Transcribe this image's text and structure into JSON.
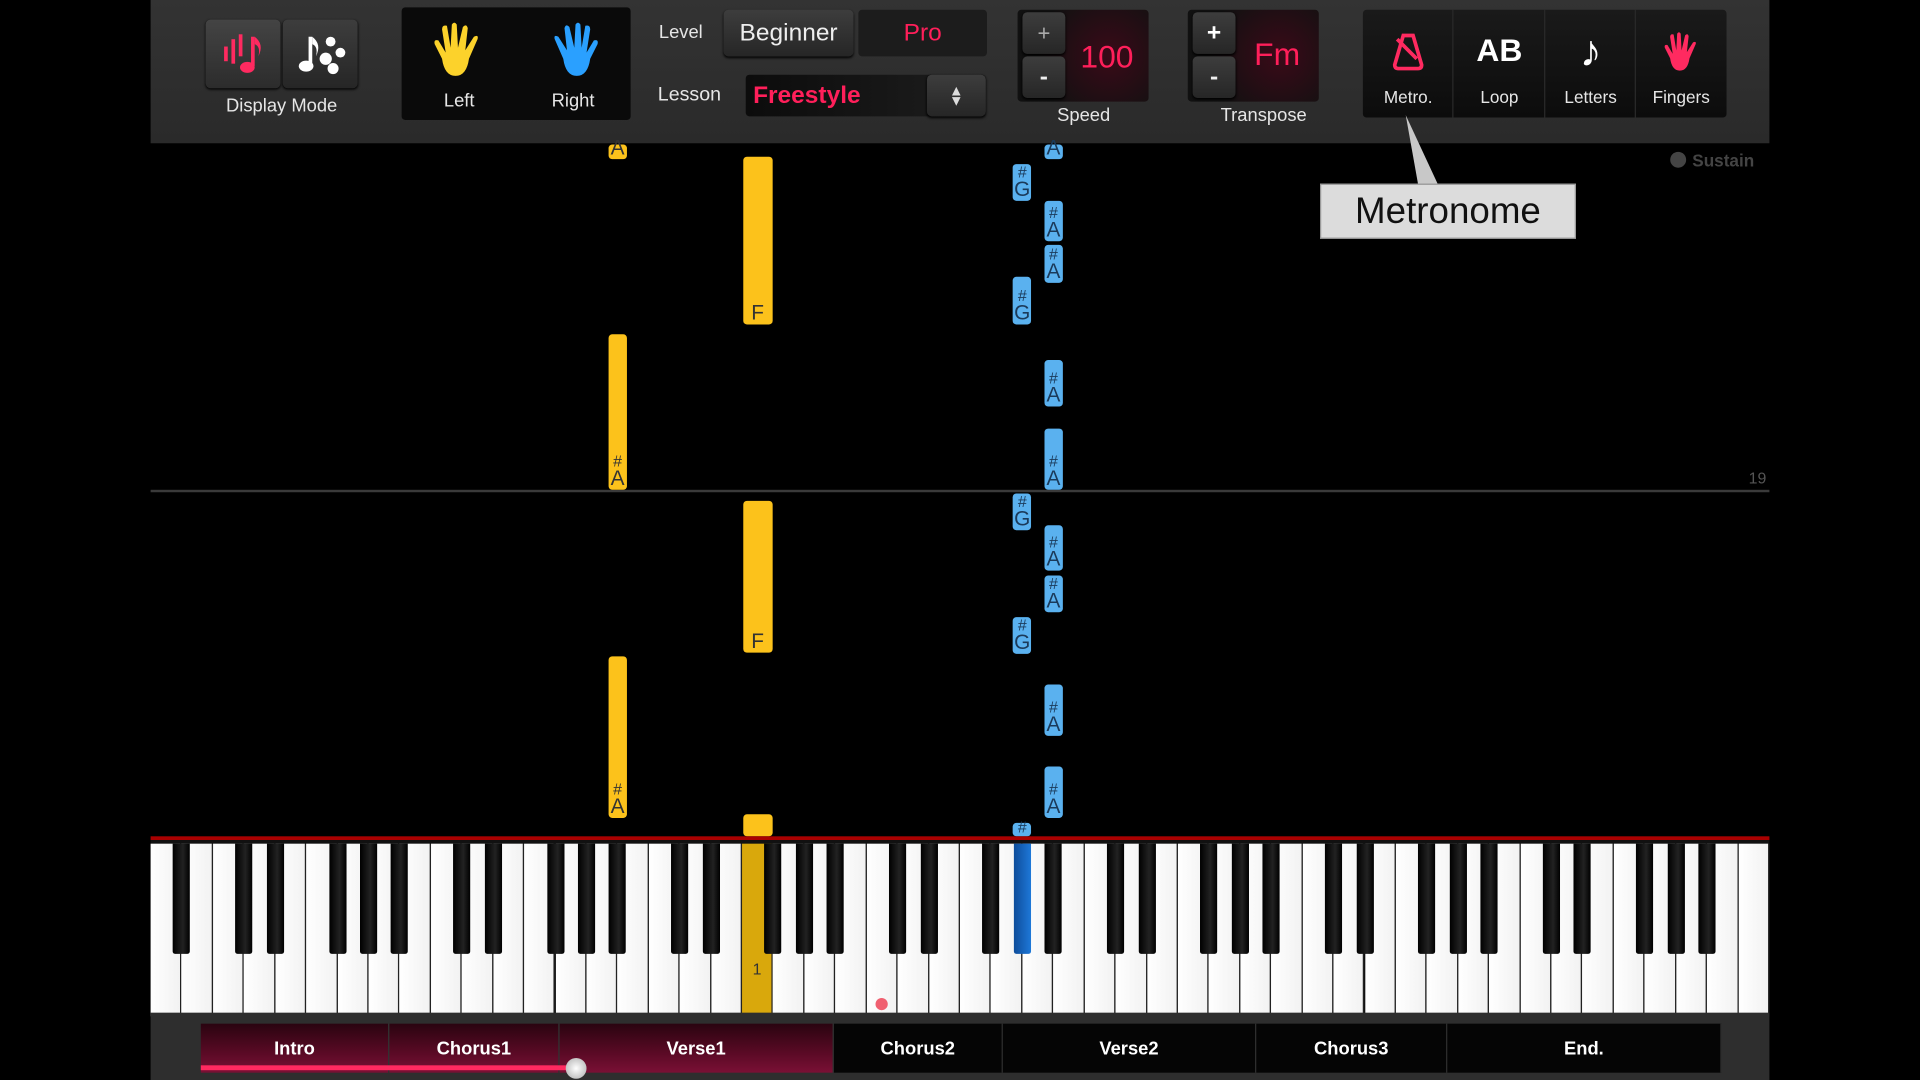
{
  "toolbar": {
    "display_mode": {
      "label": "Display Mode",
      "buttons": [
        {
          "icon": "falling-notes-icon",
          "active": true
        },
        {
          "icon": "sheet-notes-icon",
          "active": false
        }
      ]
    },
    "hands": {
      "left": "Left",
      "right": "Right",
      "left_color": "#fcc21b",
      "right_color": "#2aa0ff"
    },
    "level": {
      "label": "Level",
      "options": [
        "Beginner",
        "Pro"
      ],
      "selected": "Pro"
    },
    "lesson": {
      "label": "Lesson",
      "value": "Freestyle"
    },
    "speed": {
      "label": "Speed",
      "value": "100",
      "plus": "+",
      "minus": "-"
    },
    "transpose": {
      "label": "Transpose",
      "value": "Fm",
      "plus": "+",
      "minus": "-"
    },
    "tools": [
      {
        "label": "Metro.",
        "icon": "metronome-icon"
      },
      {
        "label": "Loop",
        "icon_text": "AB"
      },
      {
        "label": "Letters",
        "icon": "eighth-note-icon"
      },
      {
        "label": "Fingers",
        "icon": "hand-icon"
      }
    ]
  },
  "tooltip": {
    "text": "Metronome"
  },
  "sustain": {
    "label": "Sustain",
    "on": false
  },
  "measure_number": "19",
  "notes": [
    {
      "hand": "left",
      "pitch": "A#2",
      "labels": [
        "",
        "A"
      ]
    },
    {
      "hand": "left",
      "pitch": "A#2",
      "labels": [
        "#",
        "A"
      ]
    },
    {
      "hand": "left",
      "pitch": "A#2",
      "labels": [
        "#",
        "A"
      ]
    },
    {
      "hand": "left",
      "pitch": "F3",
      "labels": [
        "",
        "F"
      ]
    },
    {
      "hand": "left",
      "pitch": "F3",
      "labels": [
        "",
        "F"
      ]
    },
    {
      "hand": "left",
      "pitch": "F3",
      "labels": [
        "",
        ""
      ]
    },
    {
      "hand": "right",
      "pitch": "G#4",
      "labels": [
        "#",
        "G"
      ]
    },
    {
      "hand": "right",
      "pitch": "G#4",
      "labels": [
        "#",
        "G"
      ]
    },
    {
      "hand": "right",
      "pitch": "G#4",
      "labels": [
        "#",
        "G"
      ]
    },
    {
      "hand": "right",
      "pitch": "G#4",
      "labels": [
        "#",
        "G"
      ]
    },
    {
      "hand": "right",
      "pitch": "G#4",
      "labels": [
        "#",
        ""
      ]
    },
    {
      "hand": "right",
      "pitch": "A#4",
      "labels": [
        "",
        "A"
      ]
    },
    {
      "hand": "right",
      "pitch": "A#4",
      "labels": [
        "#",
        "A"
      ]
    },
    {
      "hand": "right",
      "pitch": "A#4",
      "labels": [
        "#",
        "A"
      ]
    },
    {
      "hand": "right",
      "pitch": "A#4",
      "labels": [
        "#",
        "A"
      ]
    },
    {
      "hand": "right",
      "pitch": "A#4",
      "labels": [
        "#",
        "A"
      ]
    },
    {
      "hand": "right",
      "pitch": "A#4",
      "labels": [
        "#",
        "A"
      ]
    },
    {
      "hand": "right",
      "pitch": "A#4",
      "labels": [
        "#",
        "A"
      ]
    },
    {
      "hand": "right",
      "pitch": "A#4",
      "labels": [
        "#",
        "A"
      ]
    },
    {
      "hand": "right",
      "pitch": "A#4",
      "labels": [
        "#",
        "A"
      ]
    }
  ],
  "keyboard": {
    "pressed": [
      {
        "key": "F3",
        "hand": "left",
        "finger": "1"
      },
      {
        "key": "G#4",
        "hand": "right"
      }
    ],
    "middle_c_marker": "C4"
  },
  "sections": [
    {
      "label": "Intro",
      "played": true
    },
    {
      "label": "Chorus1",
      "played": true
    },
    {
      "label": "Verse1",
      "played": true
    },
    {
      "label": "Chorus2",
      "played": false
    },
    {
      "label": "Verse2",
      "played": false
    },
    {
      "label": "Chorus3",
      "played": false
    },
    {
      "label": "End.",
      "played": false
    }
  ],
  "progress_percent": 24.5
}
